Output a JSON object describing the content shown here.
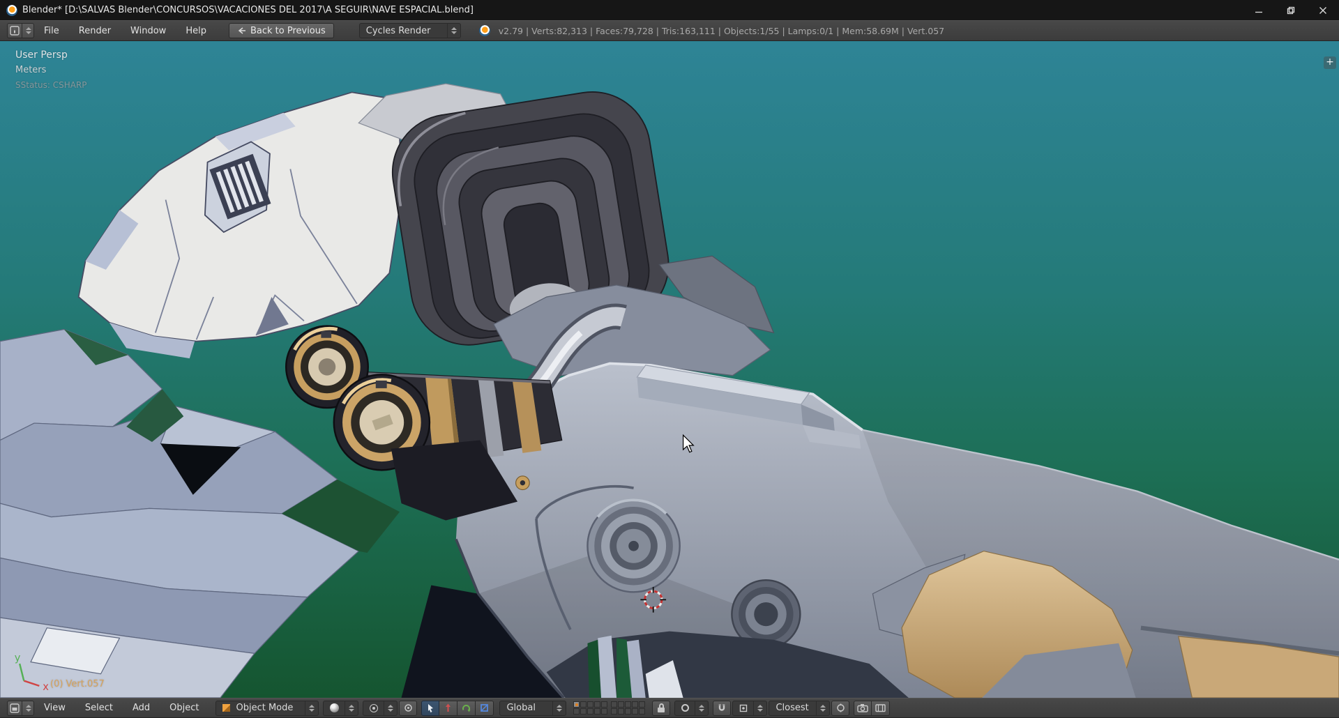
{
  "window": {
    "title": "Blender* [D:\\SALVAS Blender\\CONCURSOS\\VACACIONES DEL 2017\\A SEGUIR\\NAVE ESPACIAL.blend]"
  },
  "infobar": {
    "menus": [
      "File",
      "Render",
      "Window",
      "Help"
    ],
    "back_button": "Back to Previous",
    "render_engine": "Cycles Render",
    "stats": "v2.79 | Verts:82,313 | Faces:79,728 | Tris:163,111 | Objects:1/55 | Lamps:0/1 | Mem:58.69M | Vert.057"
  },
  "viewport": {
    "view_label": "User Persp",
    "units_label": "Meters",
    "status_label": "SStatus: CSHARP",
    "object_label": "(0) Vert.057",
    "add_button": "+",
    "axis": {
      "x": "x",
      "y": "y"
    }
  },
  "header3d": {
    "menus": [
      "View",
      "Select",
      "Add",
      "Object"
    ],
    "mode": "Object Mode",
    "orientation": "Global",
    "snap_element": "Closest"
  },
  "colors": {
    "accent_orange": "#d8a35a",
    "viewport_top": "#2e8496",
    "viewport_bottom": "#155530",
    "header_gray": "#3f3f3f"
  }
}
